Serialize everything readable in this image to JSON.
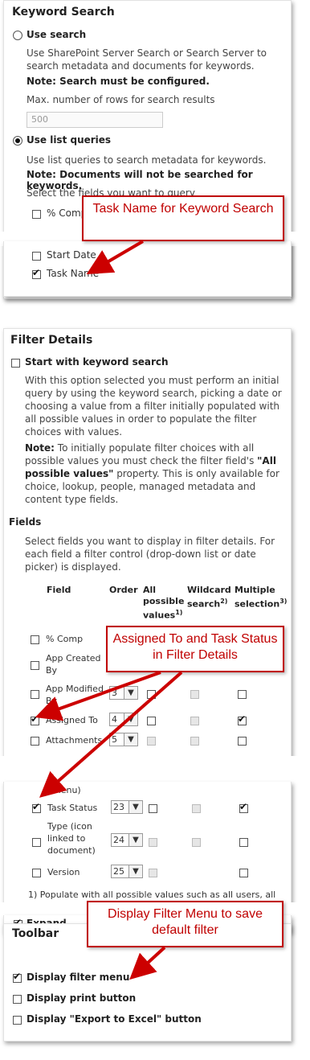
{
  "keyword_search": {
    "title": "Keyword Search",
    "use_search_label": "Use search",
    "use_search_desc": "Use SharePoint Server Search or Search Server to search metadata and documents for keywords.",
    "use_search_note": "Note: Search must be configured.",
    "max_rows_label": "Max. number of rows for search results",
    "max_rows_value": "500",
    "use_list_label": "Use list queries",
    "use_list_desc": "Use list queries to search metadata for keywords.",
    "use_list_note": "Note: Documents will not be searched for keywords.",
    "select_fields_label": "Select the fields you want to query",
    "fields": [
      {
        "label": "% Comp",
        "checked": false
      },
      {
        "label": "Start Date",
        "checked": false
      },
      {
        "label": "Task Name",
        "checked": true
      }
    ],
    "use_search_selected": false,
    "use_list_selected": true
  },
  "filter_details": {
    "title": "Filter Details",
    "start_keyword_label": "Start with keyword search",
    "start_keyword_checked": false,
    "start_desc": "With this option selected you must perform an initial query by using the keyword search, picking a date or choosing a value from a filter initially populated with all possible values in order to populate the filter choices with values.",
    "note_prefix": "Note:",
    "note_text_a": " To initially populate filter choices with all possible values you must check the filter field's ",
    "note_bold": "\"All possible values\"",
    "note_text_b": " property. This is only available for choice, lookup, people, managed metadata and content type fields.",
    "fields_heading": "Fields",
    "fields_desc": "Select fields you want to display in filter details. For each field a filter control (drop-down list or date picker) is displayed.",
    "col_field": "Field",
    "col_order": "Order",
    "col_all": "All possible values",
    "col_all_sup": "1)",
    "col_wild": "Wildcard search",
    "col_wild_sup": "2)",
    "col_multi": "Multiple selection",
    "col_multi_sup": "3)",
    "rows_top": [
      {
        "label": "% Comp",
        "checked": false,
        "order": ""
      },
      {
        "label": "App Created By",
        "checked": false,
        "order": ""
      },
      {
        "label": "App Modified By",
        "checked": false,
        "order": "3"
      },
      {
        "label": "Assigned To",
        "checked": true,
        "order": "4"
      },
      {
        "label": "Attachments",
        "checked": false,
        "order": "5"
      }
    ],
    "menu_fragment": "menu)",
    "rows_bottom": [
      {
        "label": "Task Status",
        "checked": true,
        "order": "23"
      },
      {
        "label": "Type (icon linked to document)",
        "checked": false,
        "order": "24"
      },
      {
        "label": "Version",
        "checked": false,
        "order": "25"
      }
    ],
    "footnote": "1) Populate with all possible values such as all users, all",
    "expand_label": "Expand"
  },
  "toolbar": {
    "title": "Toolbar",
    "items": [
      {
        "label": "Display filter menu",
        "checked": true
      },
      {
        "label": "Display print button",
        "checked": false
      },
      {
        "label": "Display \"Export to Excel\" button",
        "checked": false
      }
    ]
  },
  "callouts": {
    "task_name": "Task Name for Keyword Search",
    "assigned": "Assigned To and Task Status in Filter Details",
    "filter_menu": "Display Filter Menu to save default filter"
  },
  "colors": {
    "callout_red": "#c00000",
    "arrow_red": "#cc0000"
  }
}
